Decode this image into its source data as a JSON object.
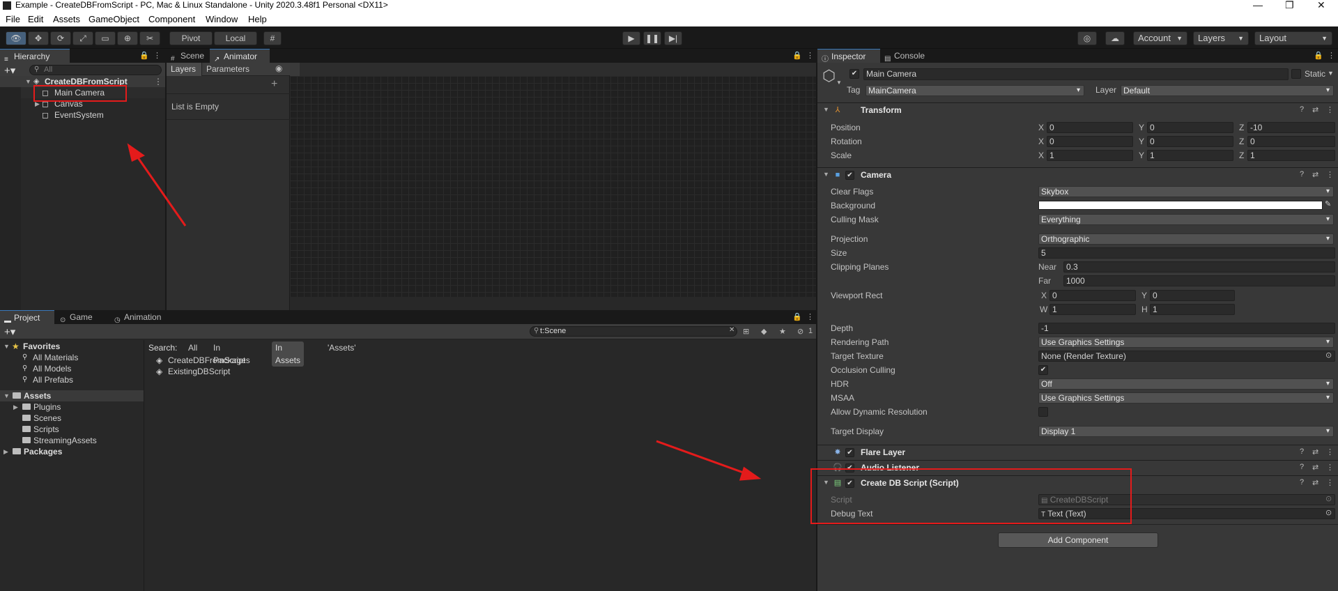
{
  "window": {
    "title": "Example - CreateDBFromScript - PC, Mac & Linux Standalone - Unity 2020.3.48f1 Personal <DX11>",
    "menu": [
      "File",
      "Edit",
      "Assets",
      "GameObject",
      "Component",
      "Window",
      "Help"
    ]
  },
  "toolbar": {
    "pivot": "Pivot",
    "local": "Local",
    "account": "Account",
    "layers": "Layers",
    "layout": "Layout"
  },
  "hierarchy": {
    "tab": "Hierarchy",
    "search_placeholder": "All",
    "scene": "CreateDBFromScript",
    "items": [
      "Main Camera",
      "Canvas",
      "EventSystem"
    ]
  },
  "scene_tabs": {
    "scene": "Scene",
    "animator": "Animator"
  },
  "animator": {
    "layers_tab": "Layers",
    "parameters_tab": "Parameters",
    "empty_text": "List is Empty"
  },
  "project": {
    "tabs": [
      "Project",
      "Game",
      "Animation"
    ],
    "search_value": "t:Scene",
    "search_label": "Search:",
    "filters": [
      "All",
      "In Packages",
      "In Assets",
      "'Assets'"
    ],
    "hidden_count": "1",
    "favorites": {
      "label": "Favorites",
      "items": [
        "All Materials",
        "All Models",
        "All Prefabs"
      ]
    },
    "assets": {
      "label": "Assets",
      "items": [
        "Plugins",
        "Scenes",
        "Scripts",
        "StreamingAssets"
      ]
    },
    "packages_label": "Packages",
    "results": [
      "CreateDBFromScript",
      "ExistingDBScript"
    ]
  },
  "inspector": {
    "tabs": [
      "Inspector",
      "Console"
    ],
    "object_name": "Main Camera",
    "static_label": "Static",
    "tag_label": "Tag",
    "tag_value": "MainCamera",
    "layer_label": "Layer",
    "layer_value": "Default",
    "transform": {
      "title": "Transform",
      "rows": [
        {
          "label": "Position",
          "x": "0",
          "y": "0",
          "z": "-10"
        },
        {
          "label": "Rotation",
          "x": "0",
          "y": "0",
          "z": "0"
        },
        {
          "label": "Scale",
          "x": "1",
          "y": "1",
          "z": "1"
        }
      ]
    },
    "camera": {
      "title": "Camera",
      "clear_flags_label": "Clear Flags",
      "clear_flags": "Skybox",
      "background_label": "Background",
      "culling_mask_label": "Culling Mask",
      "culling_mask": "Everything",
      "projection_label": "Projection",
      "projection": "Orthographic",
      "size_label": "Size",
      "size": "5",
      "clipping_label": "Clipping Planes",
      "near_label": "Near",
      "near": "0.3",
      "far_label": "Far",
      "far": "1000",
      "viewport_label": "Viewport Rect",
      "vx": "0",
      "vy": "0",
      "vw": "1",
      "vh": "1",
      "depth_label": "Depth",
      "depth": "-1",
      "rendering_path_label": "Rendering Path",
      "rendering_path": "Use Graphics Settings",
      "target_texture_label": "Target Texture",
      "target_texture": "None (Render Texture)",
      "occlusion_label": "Occlusion Culling",
      "hdr_label": "HDR",
      "hdr": "Off",
      "msaa_label": "MSAA",
      "msaa": "Use Graphics Settings",
      "dyn_res_label": "Allow Dynamic Resolution",
      "target_display_label": "Target Display",
      "target_display": "Display 1"
    },
    "flare_layer": "Flare Layer",
    "audio_listener": "Audio Listener",
    "script_component": {
      "title": "Create DB Script (Script)",
      "script_label": "Script",
      "script_value": "CreateDBScript",
      "debug_label": "Debug Text",
      "debug_value": "Text (Text)"
    },
    "add_component": "Add Component"
  },
  "annotation_color": "#e41b1b"
}
